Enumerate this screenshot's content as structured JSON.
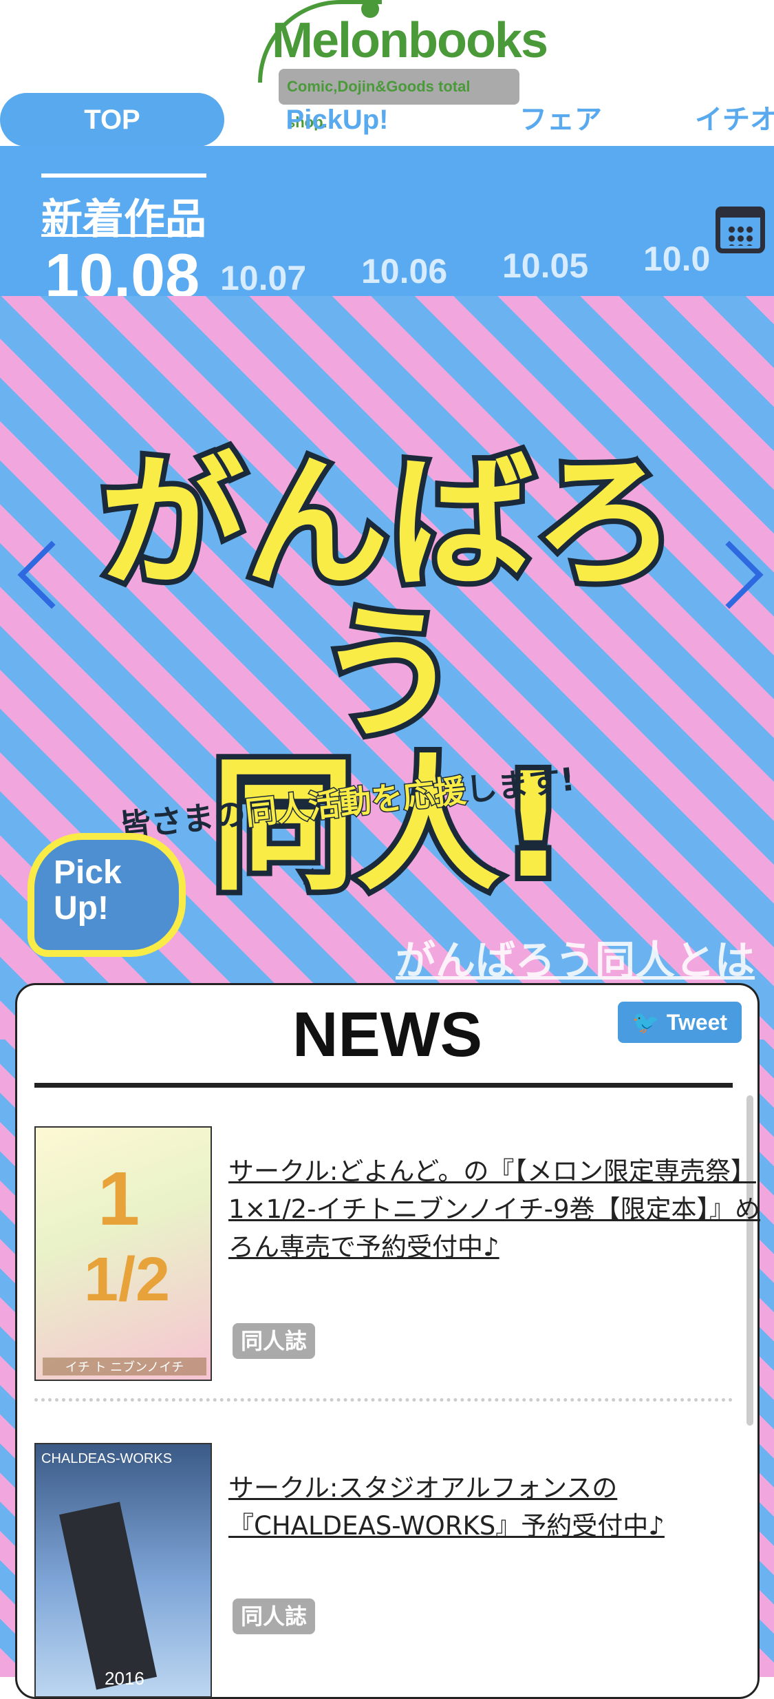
{
  "header": {
    "logo_text": "Melonbooks",
    "logo_tagline": "Comic,Dojin&Goods total shop."
  },
  "tabs": [
    {
      "label": "TOP",
      "active": true
    },
    {
      "label": "PickUp!",
      "active": false
    },
    {
      "label": "フェア",
      "active": false
    },
    {
      "label": "イチオ",
      "active": false
    }
  ],
  "new_releases": {
    "title": "新着作品",
    "dates": [
      "10.08",
      "10.07",
      "10.06",
      "10.05",
      "10.0"
    ],
    "calendar_icon": "calendar-icon"
  },
  "banner": {
    "line1": "がんばろう",
    "line2": "同人!",
    "sub_prefix": "皆さまの",
    "sub_highlight1": "同人活動を応援",
    "sub_suffix": "します!",
    "pickup_badge_line1": "Pick",
    "pickup_badge_line2": "Up!",
    "about_link": "がんばろう同人とは",
    "colors": {
      "stripe_pink": "#f2a6de",
      "stripe_blue": "#6bb3f0",
      "title_yellow": "#f9ec47"
    }
  },
  "news": {
    "title": "NEWS",
    "tweet_label": "Tweet",
    "items": [
      {
        "text": "サークル:どよんど。の『【メロン限定専売祭】1×1/2-イチトニブンノイチ-9巻【限定本】』めろん専売で予約受付中♪",
        "tag": "同人誌",
        "thumb_big": "1",
        "thumb_half": "1/2",
        "thumb_caption": "イチ ト ニブンノイチ"
      },
      {
        "text": "サークル:スタジオアルフォンスの『CHALDEAS-WORKS』予約受付中♪",
        "tag": "同人誌",
        "thumb_caption": "CHALDEAS-WORKS",
        "thumb_year": "2016"
      }
    ]
  }
}
